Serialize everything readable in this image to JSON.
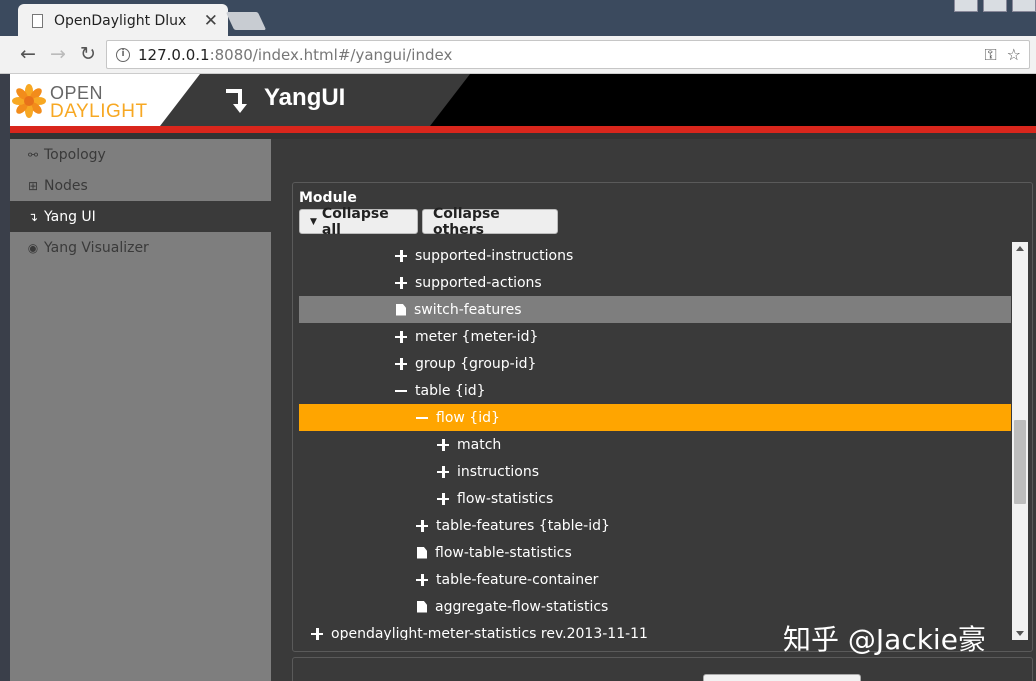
{
  "browser": {
    "tab_title": "OpenDaylight Dlux",
    "url_host": "127.0.0.1",
    "url_rest": ":8080/index.html#/yangui/index"
  },
  "header": {
    "logo_line1": "OPEN",
    "logo_line2": "DAYLIGHT",
    "title": "YangUI"
  },
  "sidebar": {
    "items": [
      {
        "label": "Topology",
        "icon": "topology-icon"
      },
      {
        "label": "Nodes",
        "icon": "nodes-icon"
      },
      {
        "label": "Yang UI",
        "icon": "yang-ui-icon",
        "active": true
      },
      {
        "label": "Yang Visualizer",
        "icon": "eye-icon"
      }
    ]
  },
  "module": {
    "label": "Module",
    "collapse_all": "Collapse all",
    "collapse_others": "Collapse others"
  },
  "tree": {
    "rows": [
      {
        "label": "supported-instructions",
        "type": "plus"
      },
      {
        "label": "supported-actions",
        "type": "plus"
      },
      {
        "label": "switch-features",
        "type": "leaf",
        "state": "selected"
      },
      {
        "label": "meter {meter-id}",
        "type": "plus"
      },
      {
        "label": "group {group-id}",
        "type": "plus"
      },
      {
        "label": "table {id}",
        "type": "minus"
      },
      {
        "label": "flow {id}",
        "type": "minus",
        "state": "active"
      },
      {
        "label": "match",
        "type": "plus"
      },
      {
        "label": "instructions",
        "type": "plus"
      },
      {
        "label": "flow-statistics",
        "type": "plus"
      },
      {
        "label": "table-features {table-id}",
        "type": "plus"
      },
      {
        "label": "flow-table-statistics",
        "type": "leaf"
      },
      {
        "label": "table-feature-container",
        "type": "plus"
      },
      {
        "label": "aggregate-flow-statistics",
        "type": "leaf"
      },
      {
        "label": "opendaylight-meter-statistics rev.2013-11-11",
        "type": "plus"
      }
    ]
  },
  "watermark": "知乎 @Jackie豪",
  "colors": {
    "accent_orange": "#ffa500",
    "header_red": "#d9261c",
    "sidebar_bg": "#7e7e7e",
    "content_bg": "#3a3a3a"
  }
}
